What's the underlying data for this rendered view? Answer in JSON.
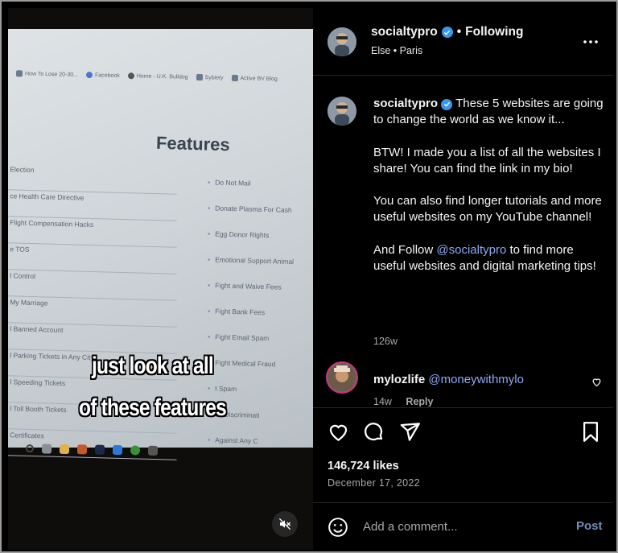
{
  "colors": {
    "background": "#000000",
    "accent": "#3897f0",
    "mention": "#8fa7f5",
    "muted": "#a8a8a8"
  },
  "video": {
    "tabs": [
      "How To Lose 20-30...",
      "Facebook",
      "Home - U.K. Bulldog",
      "Sybiety",
      "Active BV Blog"
    ],
    "heading": "Features",
    "left_features": [
      "Election",
      "ce Health Care Directive",
      "Flight Compensation Hacks",
      "e TOS",
      "l Control",
      "My Marriage",
      "l Banned Account",
      "l Parking Tickets in Any City",
      "l Speeding Tickets",
      "l Toll Booth Tickets",
      "Certificates"
    ],
    "right_features": [
      "Do Not Mail",
      "Donate Plasma For Cash",
      "Egg Donor Rights",
      "Emotional Support Animal",
      "Fight and Waive Fees",
      "Fight Bank Fees",
      "Fight Email Spam",
      "Fight Medical Fraud",
      "t Spam",
      "ce Discriminati",
      "Against Any C"
    ],
    "caption_line1": "just look at all",
    "caption_line2": "of these features",
    "mute_icon": "speaker-muted-icon"
  },
  "header": {
    "username": "socialtypro",
    "separator": "•",
    "follow_status": "Following",
    "location": "Else • Paris",
    "more_icon": "more-horizontal-icon"
  },
  "post": {
    "username": "socialtypro",
    "line1": "These 5 websites are going to change the world as we know it...",
    "paragraph2": "BTW! I made you a list of all the websites I share! You can find the link in my bio!",
    "paragraph3": "You can also find longer tutorials and more useful websites on my YouTube channel!",
    "paragraph4_pre": "And Follow ",
    "paragraph4_mention": "@socialtypro",
    "paragraph4_post": " to find more useful websites and digital marketing tips!",
    "time": "126w"
  },
  "comment": {
    "username": "mylozlife",
    "mention": "@moneywithmylo",
    "time": "14w",
    "reply_label": "Reply"
  },
  "actions": {
    "likes": "146,724 likes",
    "date": "December 17, 2022"
  },
  "add_comment": {
    "placeholder": "Add a comment...",
    "post_label": "Post"
  }
}
